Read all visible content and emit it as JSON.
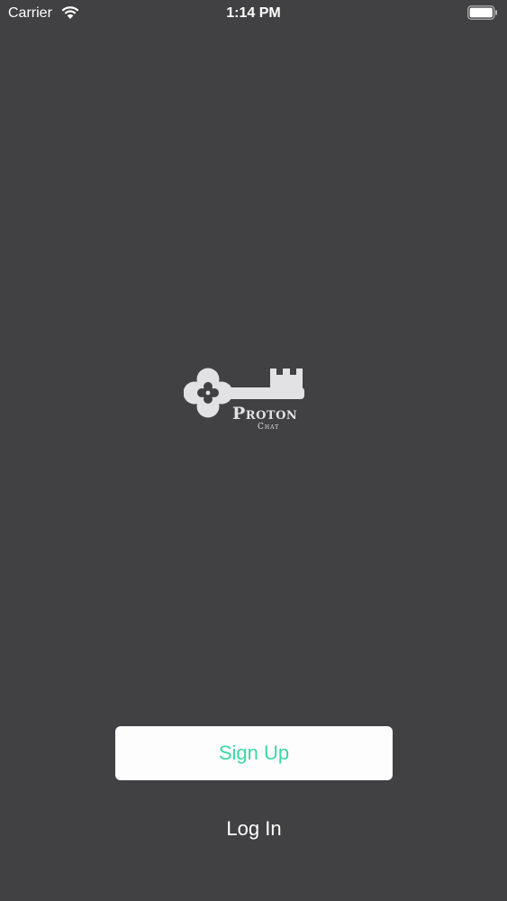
{
  "status_bar": {
    "carrier": "Carrier",
    "time": "1:14 PM",
    "wifi_icon": "wifi-icon",
    "battery_icon": "battery-icon"
  },
  "logo": {
    "title": "Proton",
    "subtitle": "Chat",
    "icon": "key-icon",
    "color": "#e2e2e4"
  },
  "actions": {
    "signup_label": "Sign Up",
    "login_label": "Log In"
  },
  "colors": {
    "background": "#414042",
    "accent": "#3ad8a2",
    "button_background": "#fdfdfe"
  }
}
